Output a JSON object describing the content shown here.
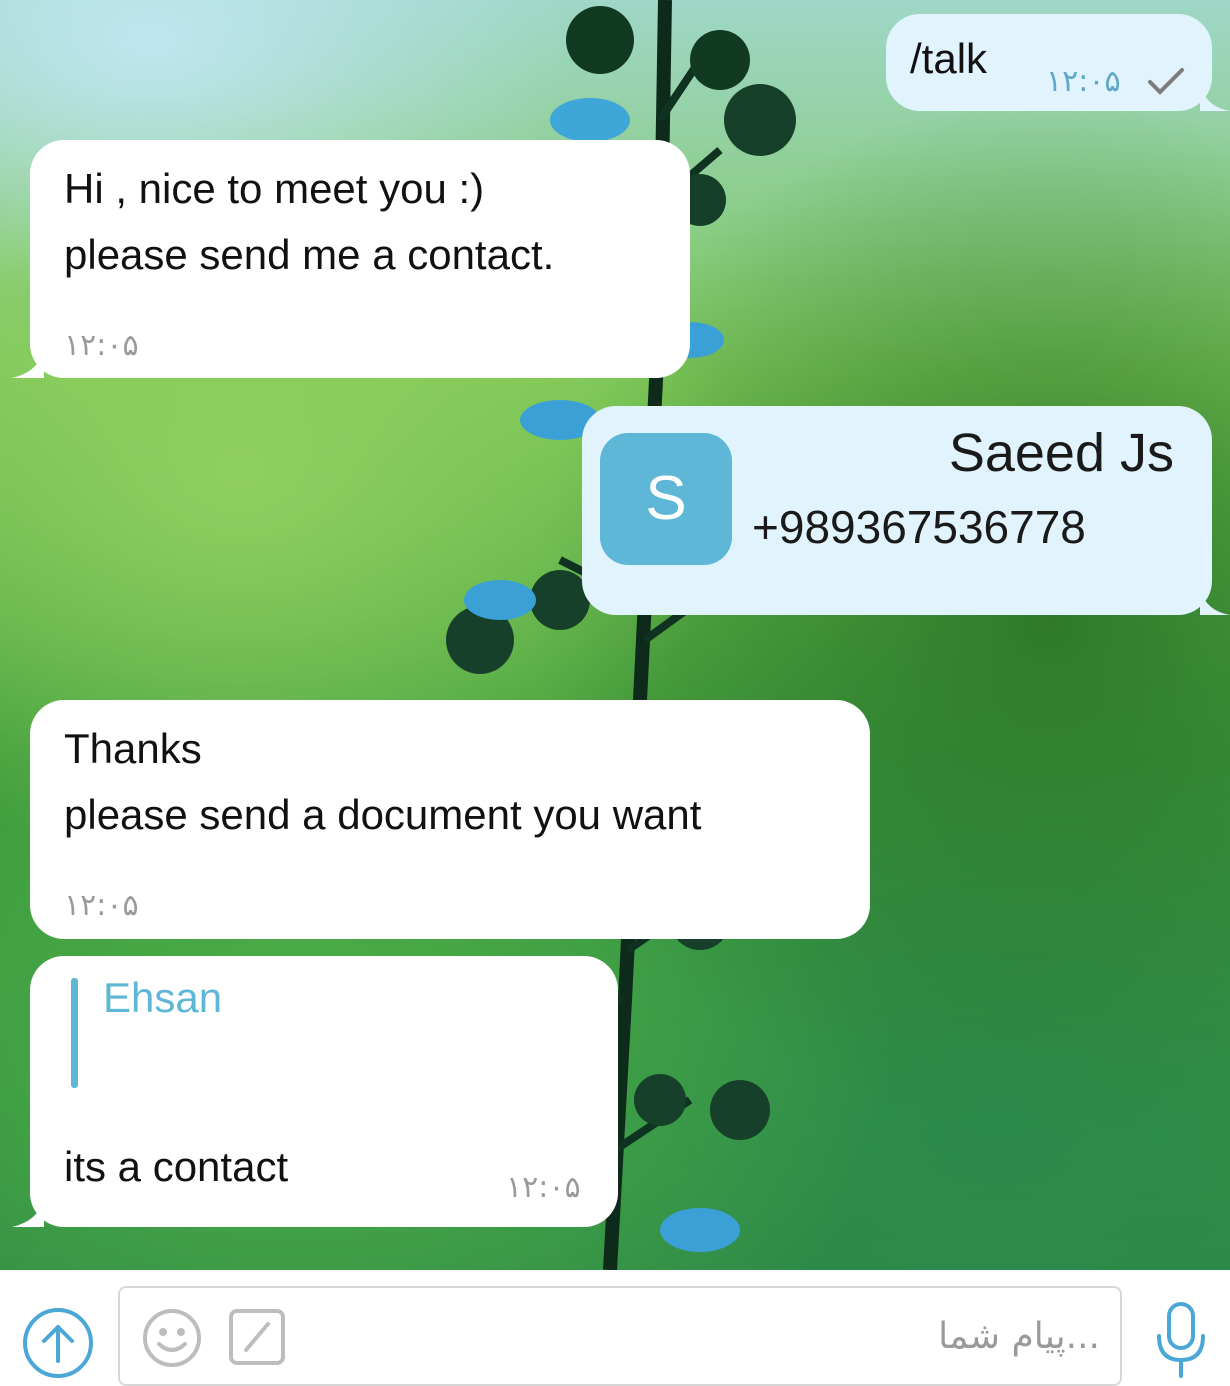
{
  "messages": [
    {
      "id": "m1",
      "side": "out",
      "text": "/talk",
      "time": "۱۲:۰۵",
      "status": "sent-check-icon"
    },
    {
      "id": "m2",
      "side": "in",
      "lines": [
        "Hi , nice to meet you :)",
        "please send me a contact."
      ],
      "time": "۱۲:۰۵"
    },
    {
      "id": "m3",
      "side": "out",
      "type": "contact",
      "avatar_letter": "S",
      "name": "Saeed Js",
      "phone": "+989367536778"
    },
    {
      "id": "m4",
      "side": "in",
      "lines": [
        "Thanks",
        "please send a document you want"
      ],
      "time": "۱۲:۰۵"
    },
    {
      "id": "m5",
      "side": "in",
      "reply_to": "Ehsan",
      "text": "its a contact",
      "time": "۱۲:۰۵"
    }
  ],
  "composer": {
    "placeholder": "پیام شما...",
    "icons": [
      "attach-upload-icon",
      "emoji-icon",
      "command-slash-icon",
      "microphone-icon"
    ]
  },
  "colors": {
    "incoming_bubble": "#ffffff",
    "outgoing_bubble": "#e1f3fc",
    "accent": "#5fb7d7",
    "time_out": "#5fa8c9"
  }
}
